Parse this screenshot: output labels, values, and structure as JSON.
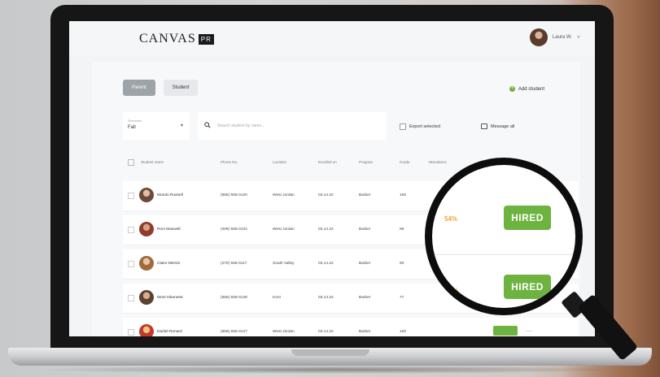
{
  "app": {
    "logo_text": "CANVAS",
    "logo_badge": "PR",
    "user_name": "Laura W.",
    "user_caret": "˅"
  },
  "toolbar": {
    "tabs": [
      {
        "label": "Parent",
        "active": true
      },
      {
        "label": "Student",
        "active": false
      }
    ],
    "add_student_label": "Add student"
  },
  "filters": {
    "select_label": "Semester",
    "select_value": "Fall",
    "search_placeholder": "Search student by name...",
    "export_label": "Export selected",
    "message_label": "Message all"
  },
  "table": {
    "columns": [
      "Student name",
      "Phone No.",
      "Location",
      "Enrolled on",
      "Program",
      "Grade",
      "Attendance"
    ],
    "rows": [
      {
        "name": "Mundo Russell",
        "phone": "(555) 555-0120",
        "location": "West Jordan",
        "enrolled": "03.14.22",
        "program": "Barber",
        "grade": "100",
        "pct": "54%",
        "hired": true
      },
      {
        "name": "Roni Maxwell",
        "phone": "(209) 555-0104",
        "location": "West Jordan",
        "enrolled": "03.14.22",
        "program": "Barber",
        "grade": "96",
        "pct": "",
        "hired": false
      },
      {
        "name": "Claire Mersin",
        "phone": "(270) 555-0117",
        "location": "South Valley",
        "enrolled": "03.14.22",
        "program": "Barber",
        "grade": "90",
        "pct": "",
        "hired": false
      },
      {
        "name": "Mont Isbaneter",
        "phone": "(555) 555-0128",
        "location": "Kent",
        "enrolled": "03.14.22",
        "program": "Barber",
        "grade": "77",
        "pct": "",
        "hired": false
      },
      {
        "name": "Darliel Ronard",
        "phone": "(555) 555-0127",
        "location": "West Jordan",
        "enrolled": "03.14.22",
        "program": "Barber",
        "grade": "100",
        "pct": "",
        "hired": true
      }
    ]
  },
  "magnifier": {
    "badge_top": "HIRED",
    "badge_bottom": "HIRED",
    "pct_top": "54%",
    "pct_bottom": "51%"
  },
  "colors": {
    "accent_green": "#6db33f",
    "warning_orange": "#f2a33a",
    "bezel": "#161616"
  }
}
